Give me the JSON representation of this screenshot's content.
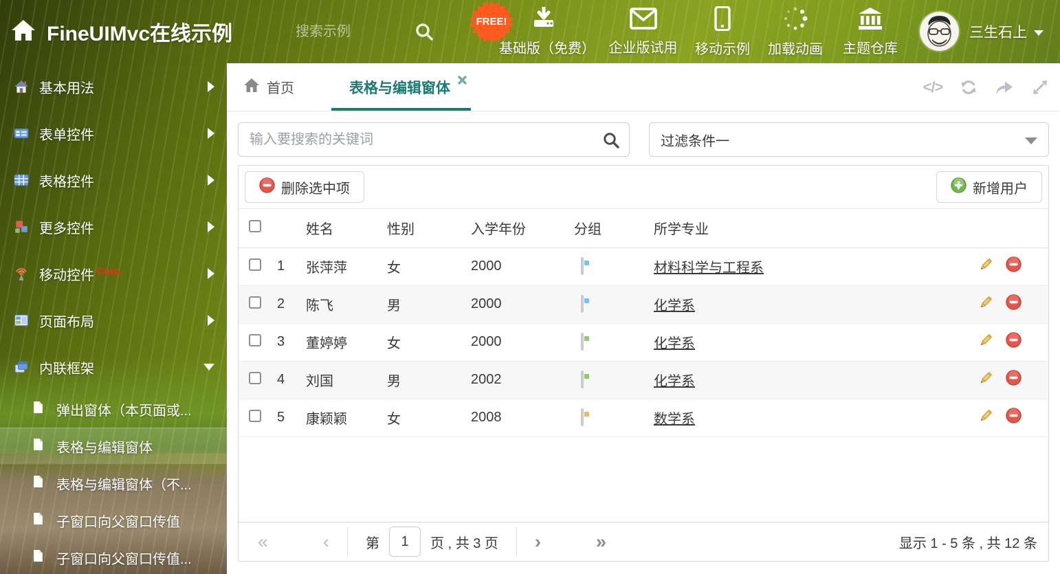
{
  "colors": {
    "accent": "#1b7a72",
    "free_badge_bg": "#ff5a1f",
    "header_text": "#ffffff",
    "tag_blue": "#7ec1ef",
    "tag_green": "#94c96e",
    "tag_orange": "#f7b26b",
    "delete_red": "#dd4a40",
    "add_green": "#6cb44a"
  },
  "icons": {
    "home-icon": "house glyph",
    "search-icon": "magnifier",
    "download-icon": "arrow into tray",
    "envelope-icon": "mail envelope",
    "mobile-icon": "smartphone",
    "spinner-icon": "loading dots",
    "bank-icon": "museum columns",
    "code-icon": "</>",
    "refresh-icon": "circular arrows",
    "share-icon": "curved arrow",
    "expand-icon": "diagonal resize arrows",
    "tag-icon": "price tag",
    "pencil-icon": "edit pencil",
    "minus-circle-icon": "red delete",
    "plus-circle-icon": "green add"
  },
  "header": {
    "brand_title": "FineUIMvc在线示例",
    "search_placeholder": "搜索示例",
    "free_badge": "FREE!",
    "nav_items": [
      {
        "label": "基础版（免费）",
        "icon": "download-icon"
      },
      {
        "label": "企业版试用",
        "icon": "envelope-icon"
      },
      {
        "label": "移动示例",
        "icon": "mobile-icon"
      },
      {
        "label": "加载动画",
        "icon": "spinner-icon"
      },
      {
        "label": "主题仓库",
        "icon": "bank-icon"
      }
    ],
    "user_name": "三生石上"
  },
  "sidebar": {
    "items": [
      {
        "label": "基本用法",
        "icon": "home-color-icon"
      },
      {
        "label": "表单控件",
        "icon": "form-icon"
      },
      {
        "label": "表格控件",
        "icon": "table-icon"
      },
      {
        "label": "更多控件",
        "icon": "cubes-icon"
      },
      {
        "label": "移动控件",
        "badge": "Corp.",
        "icon": "antenna-icon"
      },
      {
        "label": "页面布局",
        "icon": "layout-icon"
      },
      {
        "label": "内联框架",
        "icon": "frames-icon"
      }
    ],
    "subitems": [
      {
        "label": "弹出窗体（本页面或..."
      },
      {
        "label": "表格与编辑窗体",
        "selected": true
      },
      {
        "label": "表格与编辑窗体（不..."
      },
      {
        "label": "子窗口向父窗口传值"
      },
      {
        "label": "子窗口向父窗口传值..."
      }
    ]
  },
  "tabs": {
    "home_label": "首页",
    "active_label": "表格与编辑窗体"
  },
  "filters": {
    "search_placeholder": "输入要搜索的关键词",
    "dropdown_value": "过滤条件一"
  },
  "toolbar": {
    "delete_label": "删除选中项",
    "add_label": "新增用户"
  },
  "table": {
    "columns": [
      "姓名",
      "性别",
      "入学年份",
      "分组",
      "所学专业"
    ],
    "rows": [
      {
        "index": "1",
        "name": "张萍萍",
        "gender": "女",
        "year": "2000",
        "tag_color": "#7ec1ef",
        "major": "材料科学与工程系"
      },
      {
        "index": "2",
        "name": "陈飞",
        "gender": "男",
        "year": "2000",
        "tag_color": "#7ec1ef",
        "major": "化学系"
      },
      {
        "index": "3",
        "name": "董婷婷",
        "gender": "女",
        "year": "2000",
        "tag_color": "#94c96e",
        "major": "化学系"
      },
      {
        "index": "4",
        "name": "刘国",
        "gender": "男",
        "year": "2002",
        "tag_color": "#94c96e",
        "major": "化学系"
      },
      {
        "index": "5",
        "name": "康颖颖",
        "gender": "女",
        "year": "2008",
        "tag_color": "#f7b26b",
        "major": "数学系"
      }
    ]
  },
  "pagination": {
    "prefix": "第",
    "page_value": "1",
    "suffix": "页 , 共 3 页",
    "summary": "显示 1 - 5 条 , 共 12 条"
  }
}
